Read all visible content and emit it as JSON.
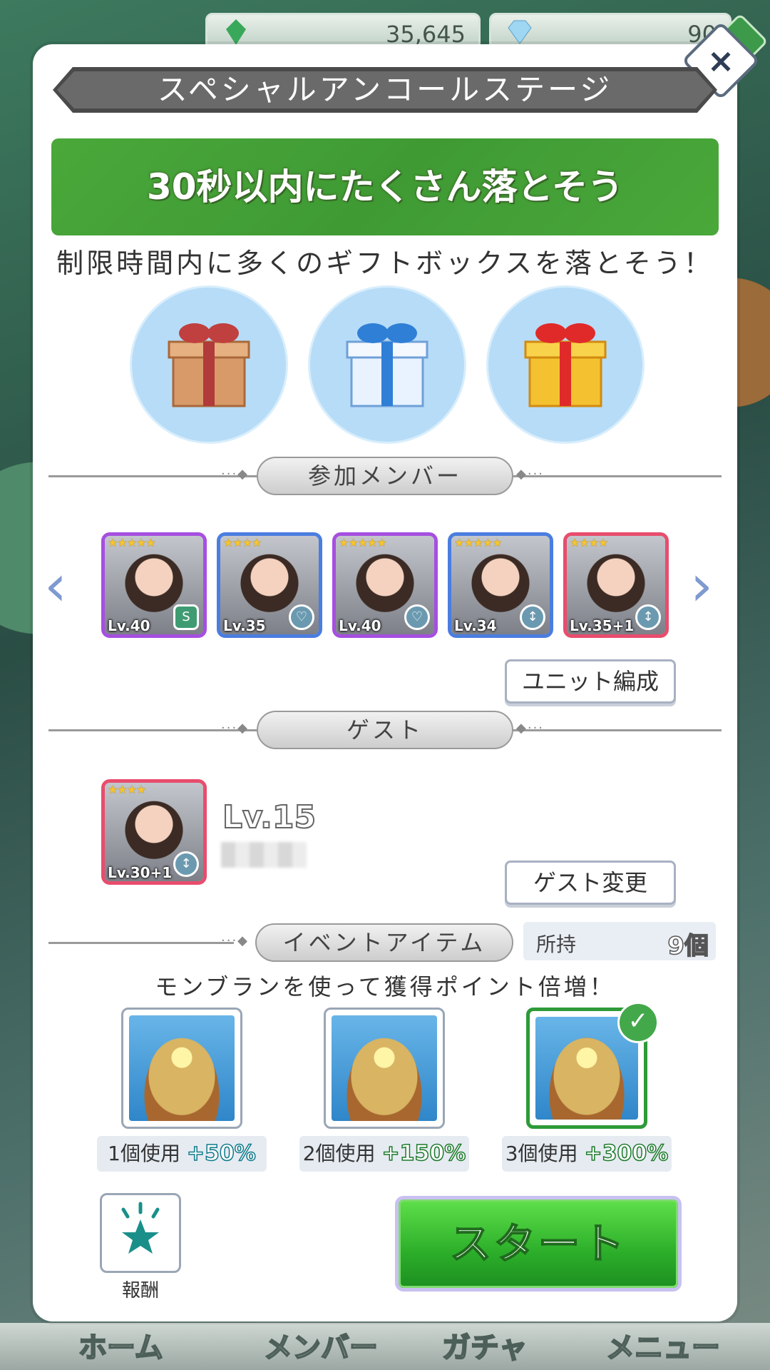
{
  "hud": {
    "green_gem_count": "35,645",
    "diamond_count": "90"
  },
  "modal": {
    "title": "スペシャルアンコールステージ",
    "mission_title": "30秒以内にたくさん落とそう",
    "mission_desc": "制限時間内に多くのギフトボックスを落とそう！"
  },
  "gifts": [
    "brown-gift-icon",
    "blue-gift-icon",
    "gold-gift-icon"
  ],
  "members_section": {
    "label": "参加メンバー",
    "cards": [
      {
        "stars": "★★★★★",
        "level": "Lv.40",
        "badge": "S",
        "frame": "purple"
      },
      {
        "stars": "★★★★",
        "level": "Lv.35",
        "badge": "♡",
        "frame": "blue"
      },
      {
        "stars": "★★★★★",
        "level": "Lv.40",
        "badge": "♡",
        "frame": "purple"
      },
      {
        "stars": "★★★★★",
        "level": "Lv.34",
        "badge": "↕",
        "frame": "blue"
      },
      {
        "stars": "★★★★",
        "level": "Lv.35+1",
        "badge": "↕",
        "frame": "pink"
      }
    ],
    "unit_button": "ユニット編成"
  },
  "guest_section": {
    "label": "ゲスト",
    "card": {
      "stars": "★★★★",
      "level": "Lv.30+1",
      "badge": "↕"
    },
    "guest_level": "Lv.15",
    "change_button": "ゲスト変更"
  },
  "event_items": {
    "label": "イベントアイテム",
    "owned_label": "所持",
    "owned_count": "9個",
    "description": "モンブランを使って獲得ポイント倍増！",
    "options": [
      {
        "label": "1個使用",
        "bonus": "+50%"
      },
      {
        "label": "2個使用",
        "bonus": "+150%"
      },
      {
        "label": "3個使用",
        "bonus": "+300%"
      }
    ]
  },
  "reward_label": "報酬",
  "start_label": "スタート",
  "nav": [
    "ホーム",
    "メンバー",
    "ガチャ",
    "メニュー"
  ],
  "colors": {
    "accent_green": "#3f9a34",
    "start_green": "#2cae2a",
    "frame_purple": "#a64fe0",
    "frame_blue": "#4a7de0",
    "frame_pink": "#e84d6d"
  }
}
